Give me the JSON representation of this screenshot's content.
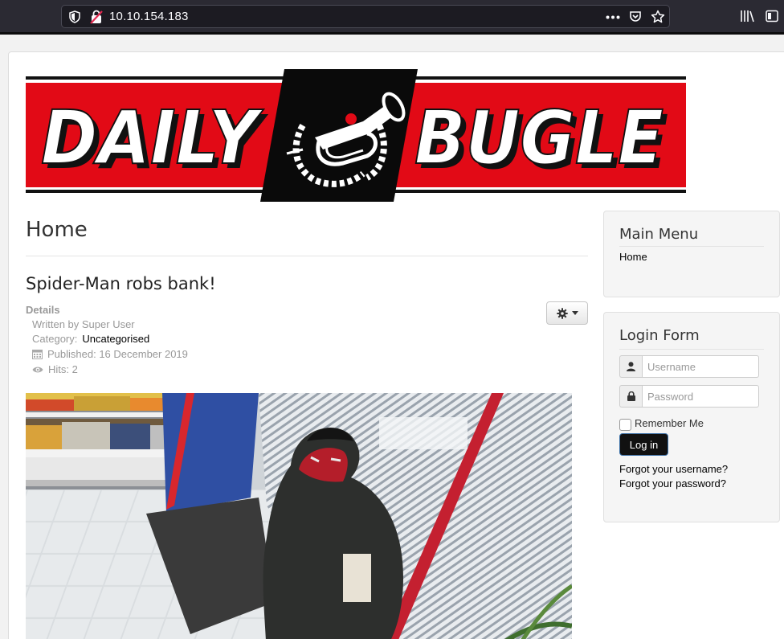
{
  "browser": {
    "url": "10.10.154.183",
    "icons": [
      "shield-icon",
      "insecure-lock-icon",
      "more-icon",
      "pocket-icon",
      "bookmark-star-icon",
      "library-icon",
      "sidebar-icon"
    ]
  },
  "site": {
    "logo_text_left": "DAILY",
    "logo_text_right": "BUGLE",
    "logo_red": "#e20a16"
  },
  "page": {
    "title": "Home"
  },
  "article": {
    "title": "Spider-Man robs bank!",
    "details_label": "Details",
    "written_by": "Written by Super User",
    "category_label": "Category:",
    "category": "Uncategorised",
    "published": "Published: 16 December 2019",
    "hits": "Hits: 2"
  },
  "sidebar": {
    "main_menu": {
      "title": "Main Menu",
      "items": [
        "Home"
      ]
    },
    "login": {
      "title": "Login Form",
      "username_placeholder": "Username",
      "password_placeholder": "Password",
      "remember_label": "Remember Me",
      "login_button": "Log in",
      "forgot_username": "Forgot your username?",
      "forgot_password": "Forgot your password?"
    }
  }
}
